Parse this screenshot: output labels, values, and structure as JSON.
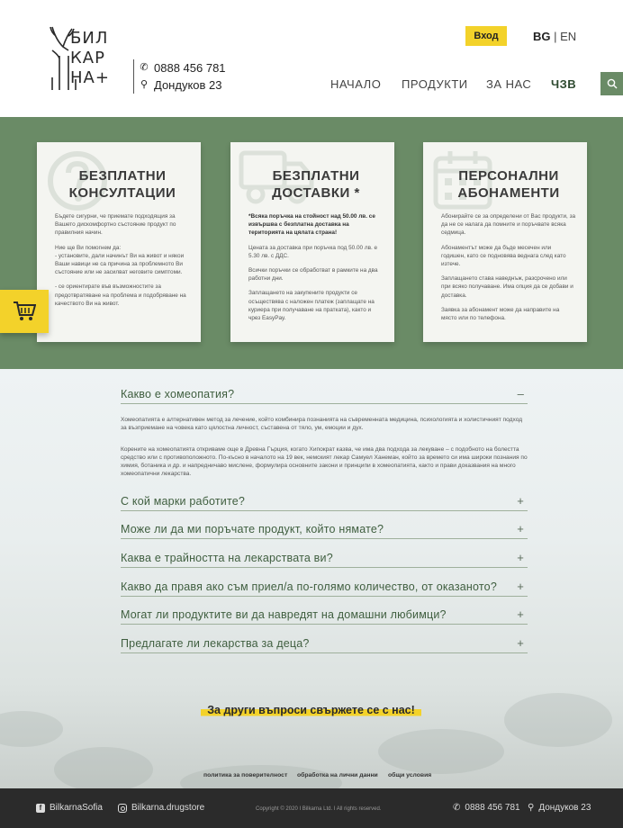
{
  "header": {
    "logo_lines": [
      "БИЛ",
      "КАР",
      "НА+"
    ],
    "phone": "0888 456 781",
    "address": "Дондуков 23",
    "login_label": "Вход",
    "lang_bg": "BG",
    "lang_sep": " | ",
    "lang_en": "EN",
    "nav": [
      "НАЧАЛО",
      "ПРОДУКТИ",
      "ЗА НАС",
      "ЧЗВ"
    ]
  },
  "cards": [
    {
      "title": "БЕЗПЛАТНИ КОНСУЛТАЦИИ",
      "icon": "question-icon",
      "paragraphs": [
        {
          "text": "Бъдете сигурни, че приемате подходящия за Вашето дискомфортно състояние продукт по правилния начин.",
          "bold": false
        },
        {
          "text": "Ние ще Ви помогнем да:\n- установите, дали начинът Ви на живот и някои Ваши навици не са причина за проблемното Ви състояние или не засилват неговите симптоми.",
          "bold": false
        },
        {
          "text": "- се ориентирате във възможностите за предотвратяване на проблема и подобряване на качеството Ви на живот.",
          "bold": false
        }
      ]
    },
    {
      "title": "БЕЗПЛАТНИ ДОСТАВКИ *",
      "icon": "truck-icon",
      "paragraphs": [
        {
          "text": "*Всяка поръчка на стойност над 50.00 лв. се извършва с безплатна доставка на територията на цялата страна!",
          "bold": true
        },
        {
          "text": "Цената за доставка при поръчка под 50.00 лв. е 5.30 лв. с ДДС.",
          "bold": false
        },
        {
          "text": "Всички поръчки се обработват в рамките на два работни дни.",
          "bold": false
        },
        {
          "text": "Заплащането на закупените продукти се осъществява с наложен платеж (заплащате на куриера при получаване на пратката), както и чрез EasyPay.",
          "bold": false
        }
      ]
    },
    {
      "title": "ПЕРСОНАЛНИ АБОНАМЕНТИ",
      "icon": "calendar-icon",
      "paragraphs": [
        {
          "text": "Абонирайте се за определени от Вас продукти, за да не се налага да помните и поръчвате всяка седмица.",
          "bold": false
        },
        {
          "text": "Абонаментът може да бъде месечен или годишен, като се подновява веднага след като изтече.",
          "bold": false
        },
        {
          "text": "Заплащането става наведнъж, разсрочено или при всяко получаване. Има опция да се добави и доставка.",
          "bold": false
        },
        {
          "text": "Заявка за абонамент може да направите на място или по телефона.",
          "bold": false
        }
      ]
    }
  ],
  "faq": [
    {
      "question": "Какво е хомеопатия?",
      "sign": "–",
      "open": true,
      "answer": [
        "Хомеопатията е алтернативен метод за лечение, който комбинира познанията на съвременната медицина, психологията и холистичният подход за възприемане на човека като цялостна личност, съставена от тяло, ум, емоции и дух.",
        "Корените на хомеопатията откриваме още в Древна Гърция, когато Хипократ казва, че има два подхода за лекуване – с подобното на болестта средство или с противоположното. По-късно в началото на 19 век, немският лекар Самуел Ханеман, който за времето си има широки познания по химия, ботаника и др. и напредничаво мислене, формулира основните закони и принципи в хомеопатията, както и прави доказвания на много хомеопатични лекарства."
      ]
    },
    {
      "question": "С кой марки работите?",
      "sign": "+",
      "open": false
    },
    {
      "question": "Може ли да ми поръчате продукт, който нямате?",
      "sign": "+",
      "open": false
    },
    {
      "question": "Каква е трайността на лекарствата ви?",
      "sign": "+",
      "open": false
    },
    {
      "question": "Какво да правя ако съм приел/а по-голямо количество, от оказаното?",
      "sign": "+",
      "open": false
    },
    {
      "question": "Могат ли продуктите ви да навредят на домашни любимци?",
      "sign": "+",
      "open": false
    },
    {
      "question": "Предлагате ли лекарства за деца?",
      "sign": "+",
      "open": false
    }
  ],
  "cta": "За други въпроси свържете се с нас!",
  "legal_links": [
    "политика за поверителност",
    "обработка на лични данни",
    "общи условия"
  ],
  "footer": {
    "facebook": "BilkarnaSofia",
    "instagram": "Bilkarna.drugstore",
    "copyright": "Copyright © 2020  I  Bilkarna Ltd.  I  All rights reserved.",
    "phone": "0888 456 781",
    "address": "Дондуков 23"
  },
  "colors": {
    "green": "#6a8b66",
    "yellow": "#f3d22a",
    "dark": "#2b2b2b"
  }
}
